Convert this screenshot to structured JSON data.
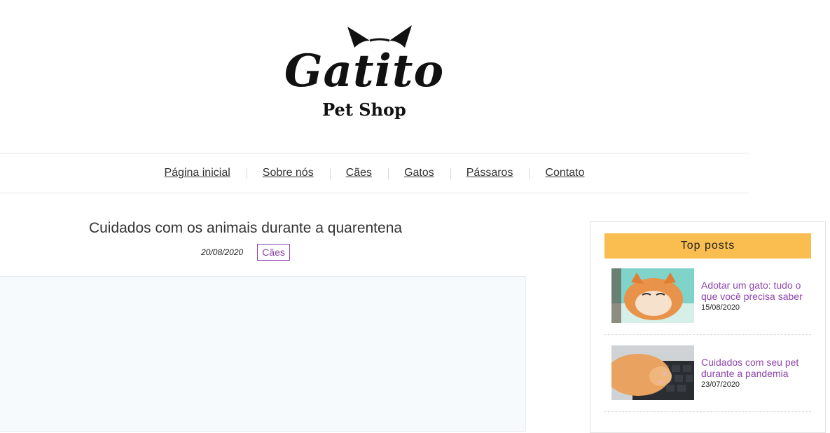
{
  "logo": {
    "main": "Gatito",
    "sub": "Pet Shop"
  },
  "nav": {
    "items": [
      {
        "label": "Página inicial"
      },
      {
        "label": "Sobre nós"
      },
      {
        "label": "Cães"
      },
      {
        "label": "Gatos"
      },
      {
        "label": "Pássaros"
      },
      {
        "label": "Contato"
      }
    ]
  },
  "post": {
    "title": "Cuidados com os animais durante a quarentena",
    "date": "20/08/2020",
    "tag": "Cães"
  },
  "sidebar": {
    "title": "Top posts",
    "posts": [
      {
        "title": "Adotar um gato: tudo o que você precisa saber",
        "date": "15/08/2020"
      },
      {
        "title": "Cuidados com seu pet durante a pandemia",
        "date": "23/07/2020"
      }
    ]
  },
  "colors": {
    "accent": "#8e44ad",
    "sidebar_header": "#f9be4f"
  }
}
